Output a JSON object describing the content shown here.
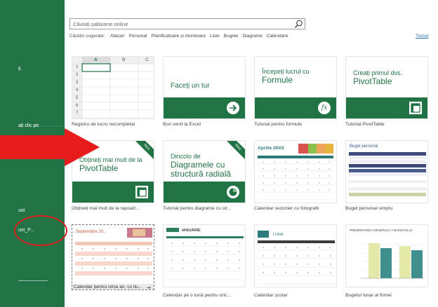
{
  "sidebar": {
    "labels": [
      "ți.",
      "ați clic pe",
      "ust",
      "ust_P..."
    ]
  },
  "search": {
    "placeholder": "Căutați șabloane online"
  },
  "suggestions": {
    "label": "Căutări sugerate:",
    "items": [
      "Afaceri",
      "Personal",
      "Planificatoare și monitoare",
      "Liste",
      "Bugete",
      "Diagrame",
      "Calendare"
    ],
    "skip": "Trecet"
  },
  "tiles": {
    "blank": {
      "caption": "Registru de lucru necompletat",
      "columns": [
        "A",
        "B",
        "C"
      ],
      "rows": [
        "1",
        "2",
        "3",
        "4",
        "5",
        "6",
        "7"
      ]
    },
    "tour": {
      "title": "Faceți un tur",
      "caption": "Bun venit la Excel"
    },
    "formulas": {
      "title": "Începeți lucrul cu",
      "subtitle": "Formule",
      "caption": "Tutorial pentru formule",
      "icon": "fx"
    },
    "pivot": {
      "title": "Creați primul dvs.",
      "subtitle": "PivotTable",
      "caption": "Tutorial PivotTable"
    },
    "pivot_more": {
      "title": "Obțineți mai mult de la",
      "subtitle": "PivotTable",
      "caption": "Obțineți mai mult de la rapoart...",
      "badge": "Nou"
    },
    "pie": {
      "title": "Dincolo de",
      "subtitle": "Diagramele cu structură radială",
      "caption": "Tutorial pentru diagrame cu str...",
      "badge": "Nou"
    },
    "seasonal": {
      "title": "Aprilie 20XX",
      "caption": "Calendar sezonier cu fotografii"
    },
    "budget": {
      "title": "Buget personal",
      "caption": "Buget personal simplu"
    },
    "any_year": {
      "title": "Septembrie 20...",
      "caption": "Calendar pentru orice an, cu ilu..."
    },
    "monthly": {
      "title": "IANUARIE",
      "caption": "Calendar pe o lună pentru oric..."
    },
    "school": {
      "title": "LUNA",
      "caption": "Calendar școlar"
    },
    "company_budget": {
      "title": "PREZENTAREA GENERALĂ A BUGETULUI",
      "caption": "Bugetul lunar al firmei"
    }
  },
  "colors": {
    "excel_green": "#217346",
    "annotation_red": "#e81c1c"
  }
}
